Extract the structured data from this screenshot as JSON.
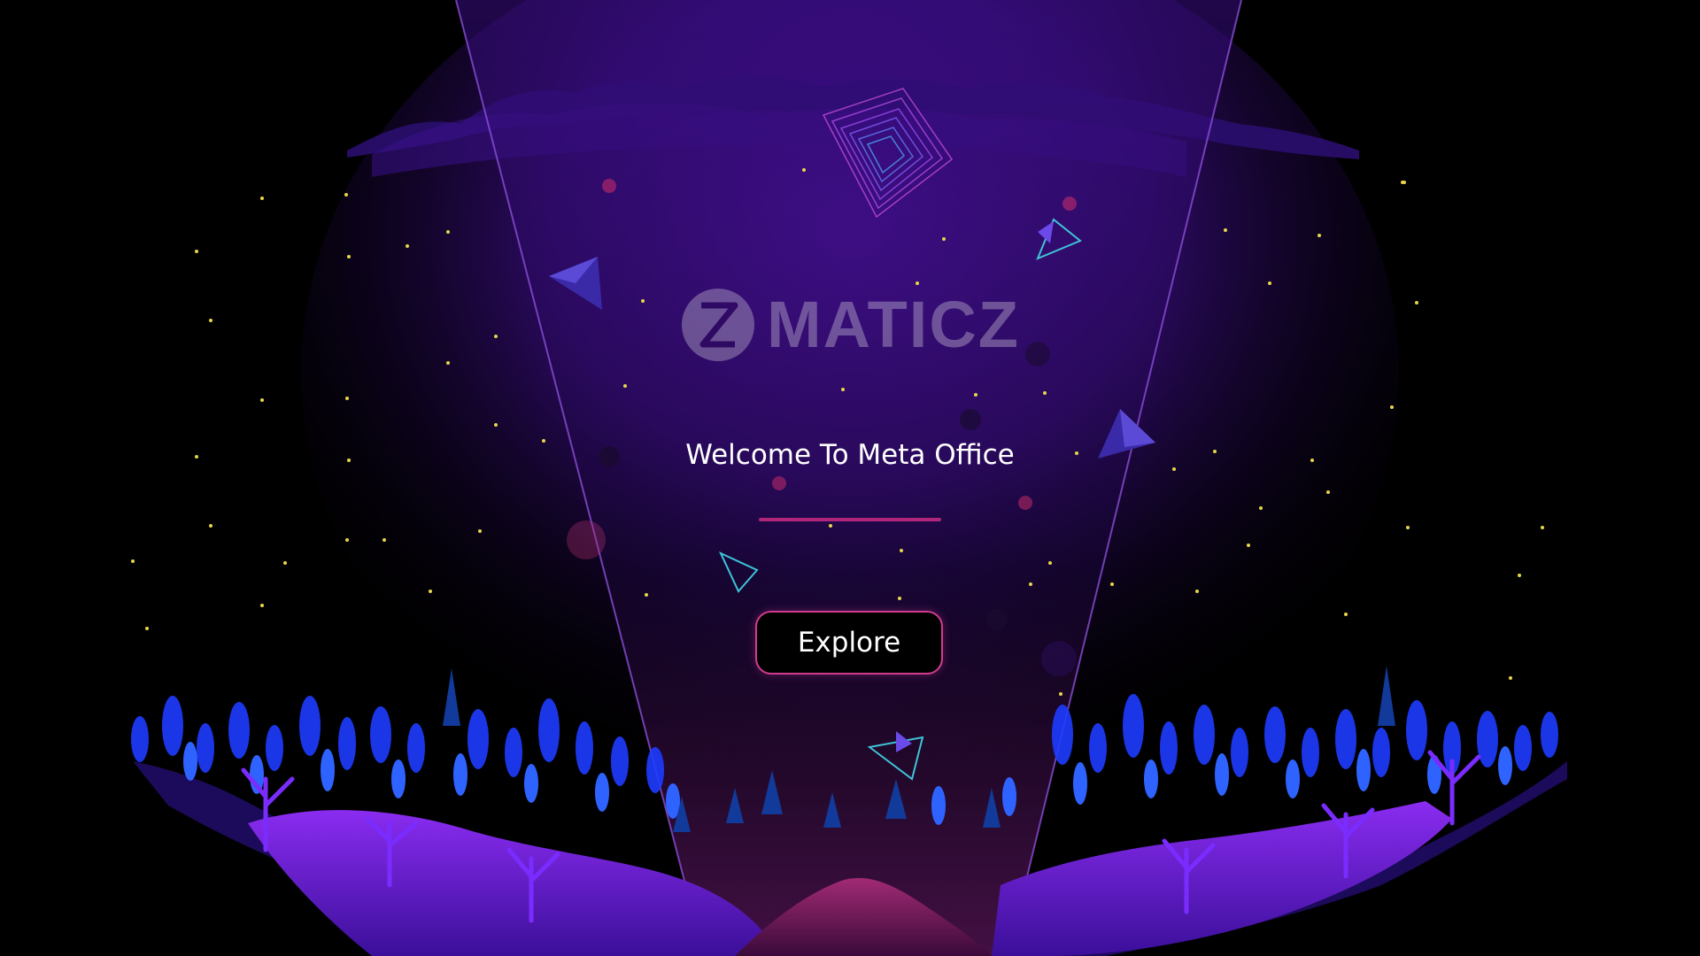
{
  "brand": {
    "name": "MATICZ",
    "icon": "z-hourglass-logo-icon"
  },
  "welcome": {
    "title": "Welcome To Meta Office"
  },
  "actions": {
    "explore_label": "Explore"
  },
  "colors": {
    "background": "#000000",
    "accent_pink": "#d13b8e",
    "underline": "#b0267a",
    "purple_glow": "#3a0c7a",
    "plant_blue": "#1e3cff",
    "plant_violet": "#7a2cff",
    "star_yellow": "#e7d64a"
  }
}
